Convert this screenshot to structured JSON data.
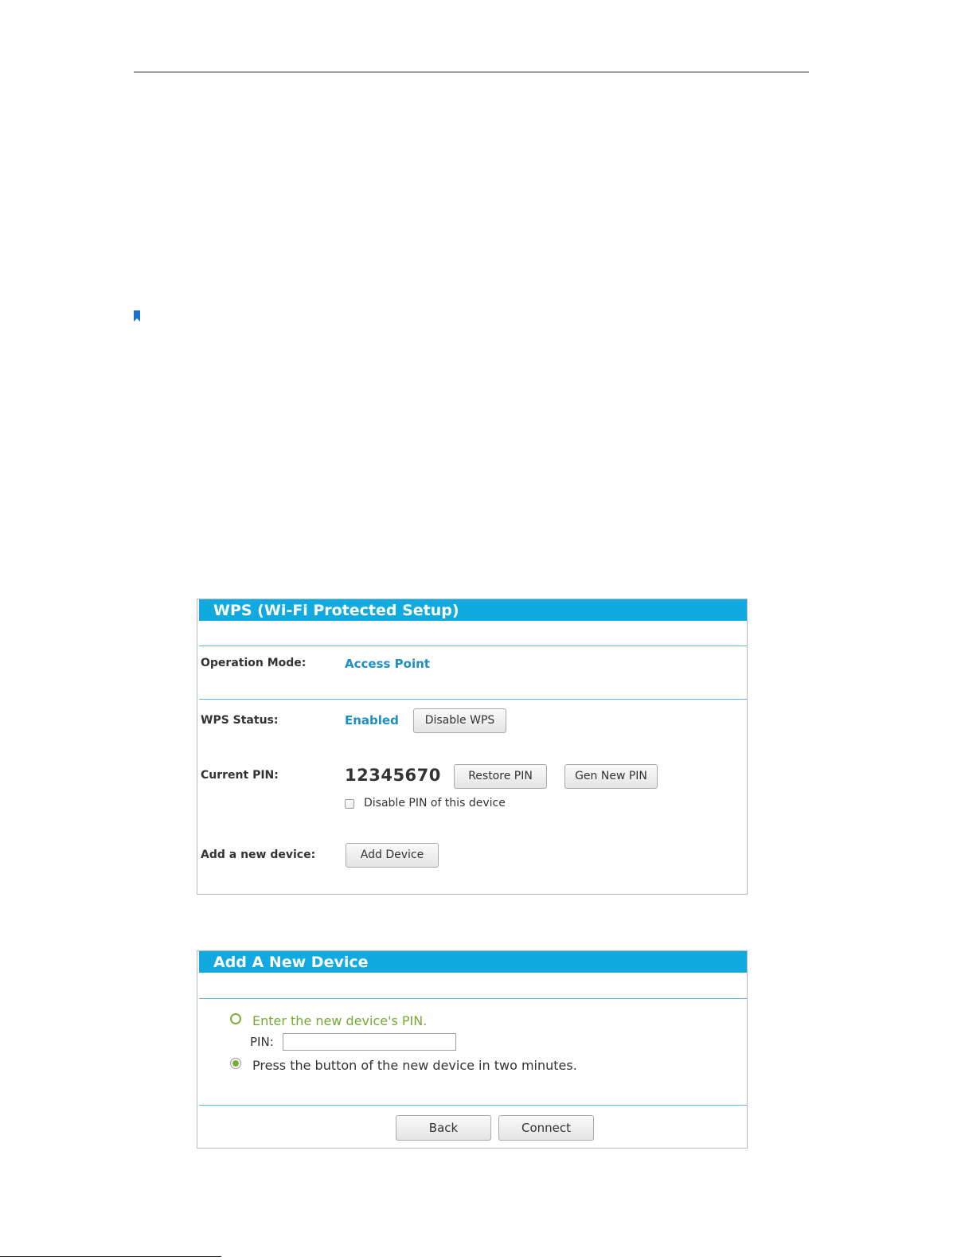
{
  "wps_panel": {
    "title": "WPS (Wi-Fi Protected Setup)",
    "operation_mode": {
      "label": "Operation Mode:",
      "value": "Access Point"
    },
    "wps_status": {
      "label": "WPS Status:",
      "value": "Enabled",
      "button": "Disable WPS"
    },
    "current_pin": {
      "label": "Current PIN:",
      "value": "12345670",
      "restore_button": "Restore PIN",
      "gen_button": "Gen New PIN",
      "disable_checkbox_label": "Disable PIN of this device",
      "disable_checked": false
    },
    "add_device": {
      "label": "Add a new device:",
      "button": "Add Device"
    }
  },
  "add_panel": {
    "title": "Add A New Device",
    "option_pin": {
      "label": "Enter the new device's PIN.",
      "selected": false
    },
    "pin_field": {
      "label": "PIN:",
      "value": "",
      "placeholder": ""
    },
    "option_button": {
      "label": "Press the button of the new device in two minutes.",
      "selected": true
    },
    "back_button": "Back",
    "connect_button": "Connect"
  },
  "colors": {
    "header": "#10a9e0",
    "accent_blue": "#1c8fc6",
    "accent_green": "#76a933"
  }
}
